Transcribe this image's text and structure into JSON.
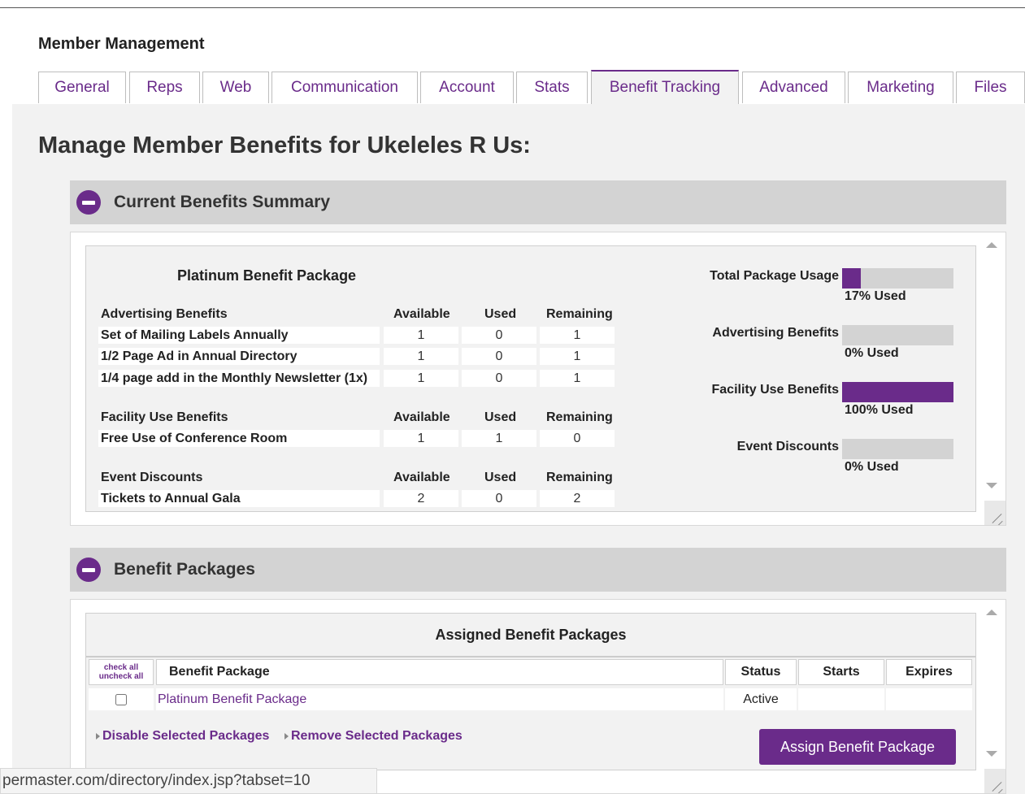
{
  "header": {
    "title": "Member Management"
  },
  "tabs": [
    {
      "label": "General"
    },
    {
      "label": "Reps"
    },
    {
      "label": "Web"
    },
    {
      "label": "Communication"
    },
    {
      "label": "Account"
    },
    {
      "label": "Stats"
    },
    {
      "label": "Benefit Tracking"
    },
    {
      "label": "Advanced"
    },
    {
      "label": "Marketing"
    },
    {
      "label": "Files"
    }
  ],
  "active_tab": "Benefit Tracking",
  "page": {
    "heading": "Manage Member Benefits for Ukeleles R Us:"
  },
  "summary": {
    "panel_title": "Current Benefits Summary",
    "package_title": "Platinum Benefit Package",
    "col_available": "Available",
    "col_used": "Used",
    "col_remaining": "Remaining",
    "groups": [
      {
        "name": "Advertising Benefits",
        "rows": [
          {
            "name": "Set of Mailing Labels Annually",
            "available": "1",
            "used": "0",
            "remaining": "1"
          },
          {
            "name": "1/2 Page Ad in Annual Directory",
            "available": "1",
            "used": "0",
            "remaining": "1"
          },
          {
            "name": "1/4 page add in the Monthly Newsletter (1x)",
            "available": "1",
            "used": "0",
            "remaining": "1"
          }
        ]
      },
      {
        "name": "Facility Use Benefits",
        "rows": [
          {
            "name": "Free Use of Conference Room",
            "available": "1",
            "used": "1",
            "remaining": "0"
          }
        ]
      },
      {
        "name": "Event Discounts",
        "rows": [
          {
            "name": "Tickets to Annual Gala",
            "available": "2",
            "used": "0",
            "remaining": "2"
          }
        ]
      }
    ],
    "usage": [
      {
        "label": "Total Package Usage",
        "percent": 17,
        "text": "17% Used"
      },
      {
        "label": "Advertising Benefits",
        "percent": 0,
        "text": "0% Used"
      },
      {
        "label": "Facility Use Benefits",
        "percent": 100,
        "text": "100% Used"
      },
      {
        "label": "Event Discounts",
        "percent": 0,
        "text": "0% Used"
      }
    ],
    "accent_color": "#6a2b8a"
  },
  "packages": {
    "panel_title": "Benefit Packages",
    "table_title": "Assigned Benefit Packages",
    "check_all": "check all",
    "uncheck_all": "uncheck all",
    "col_package": "Benefit Package",
    "col_status": "Status",
    "col_starts": "Starts",
    "col_expires": "Expires",
    "rows": [
      {
        "package": "Platinum Benefit Package",
        "status": "Active",
        "starts": "",
        "expires": "",
        "checked": false
      }
    ],
    "disable_link": "Disable Selected Packages",
    "remove_link": "Remove Selected Packages",
    "assign_button": "Assign Benefit Package"
  },
  "statusbar": {
    "url": "permaster.com/directory/index.jsp?tabset=10"
  }
}
